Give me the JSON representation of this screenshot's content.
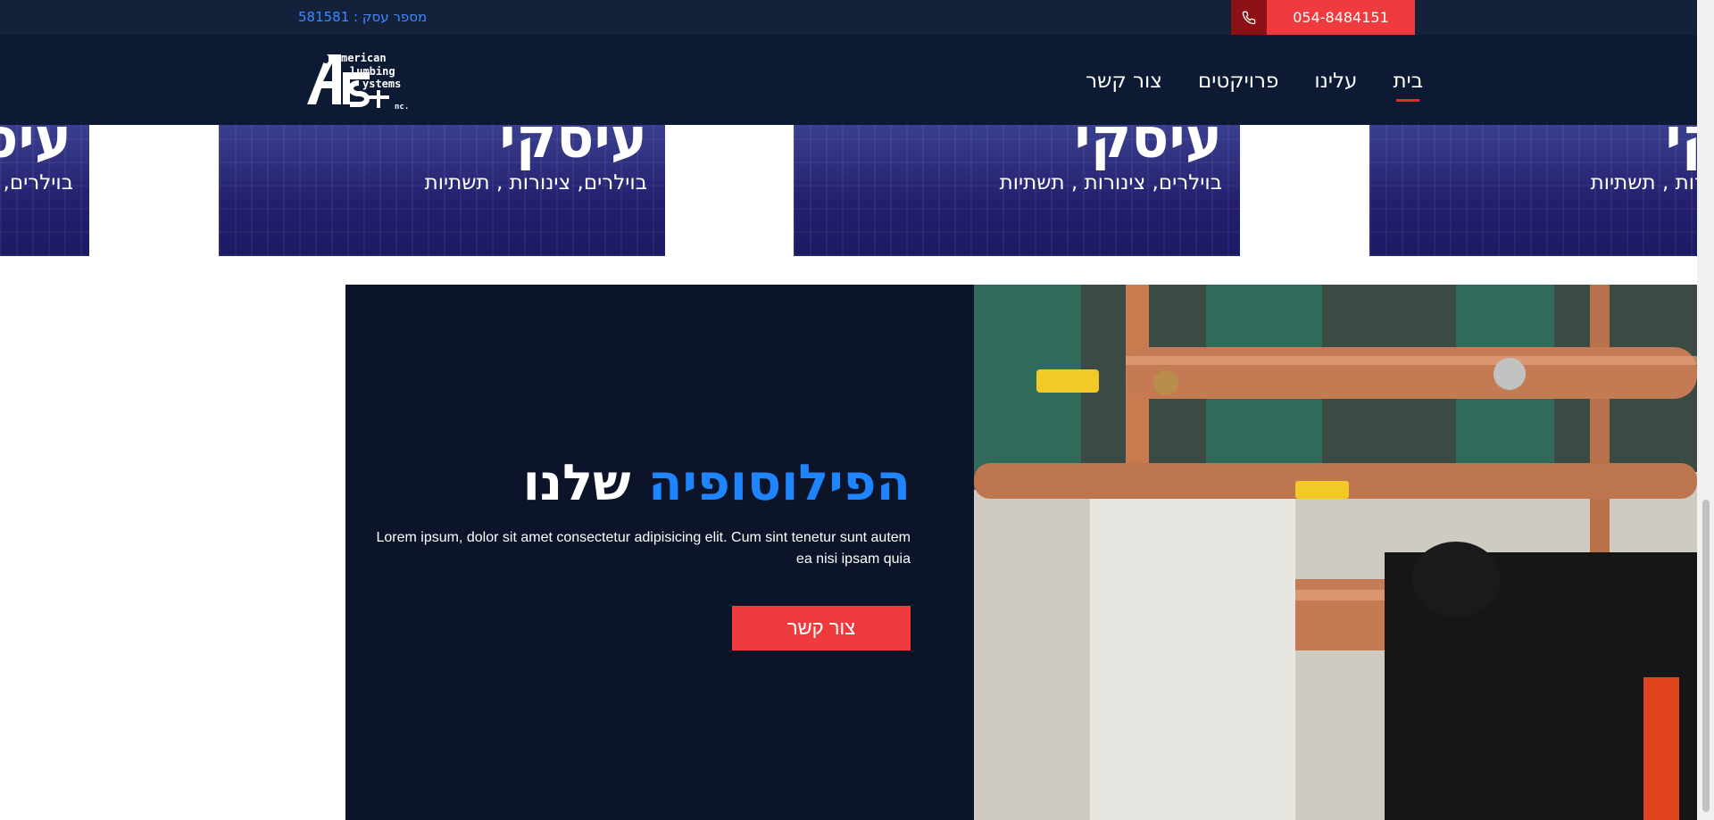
{
  "topbar": {
    "business_number": "מספר עסק : 581581",
    "phone": "054-8484151"
  },
  "logo": {
    "line1": "merican",
    "line2": "lumbing",
    "line3": "ystems",
    "line4": "nc.",
    "letters": "APSI"
  },
  "nav": {
    "items": [
      "בית",
      "עלינו",
      "פרויקטים",
      "צור קשר"
    ],
    "active": "בית"
  },
  "cards": [
    {
      "title": "עיסקי",
      "subtitle": "בוילרים, צינורות , תשתיות"
    },
    {
      "title": "עיסקי",
      "subtitle": "בוילרים, צינורות , תשתיות"
    },
    {
      "title": "עיסקי",
      "subtitle": "בוילרים, צינורות , תשתיות"
    },
    {
      "title": "עיסקי",
      "subtitle": "בוילרים, צינורות , תשתיות"
    }
  ],
  "philosophy": {
    "title_highlight": "הפילוסופיה",
    "title_rest": "שלנו",
    "text": "Lorem ipsum, dolor sit amet consectetur adipisicing elit. Cum sint tenetur sunt autem ea nisi ipsam quia",
    "button": "צור קשר"
  },
  "colors": {
    "topbar_bg": "#14213a",
    "nav_bg": "#0d1a33",
    "accent_red": "#ef3b3e",
    "accent_blue": "#1e84ff",
    "section_bg": "#0b1428"
  },
  "icons": [
    "phone-icon"
  ]
}
